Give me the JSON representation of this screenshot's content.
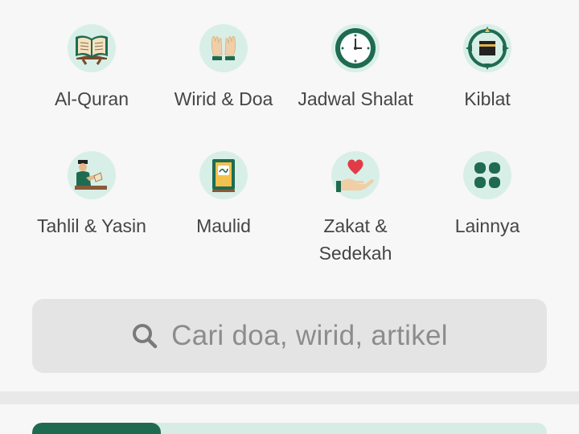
{
  "menu": {
    "items": [
      {
        "label": "Al-Quran",
        "icon": "open-book-icon"
      },
      {
        "label": "Wirid & Doa",
        "icon": "praying-hands-icon"
      },
      {
        "label": "Jadwal Shalat",
        "icon": "clock-icon"
      },
      {
        "label": "Kiblat",
        "icon": "kaaba-compass-icon"
      },
      {
        "label": "Tahlil & Yasin",
        "icon": "reading-man-icon"
      },
      {
        "label": "Maulid",
        "icon": "holy-book-icon"
      },
      {
        "label": "Zakat & Sedekah",
        "icon": "giving-hand-heart-icon"
      },
      {
        "label": "Lainnya",
        "icon": "more-grid-icon"
      }
    ]
  },
  "search": {
    "placeholder": "Cari doa, wirid, artikel",
    "icon": "search-icon"
  },
  "colors": {
    "icon_bg": "#d8efe7",
    "primary_green": "#1f6b52",
    "background": "#f7f7f7"
  }
}
